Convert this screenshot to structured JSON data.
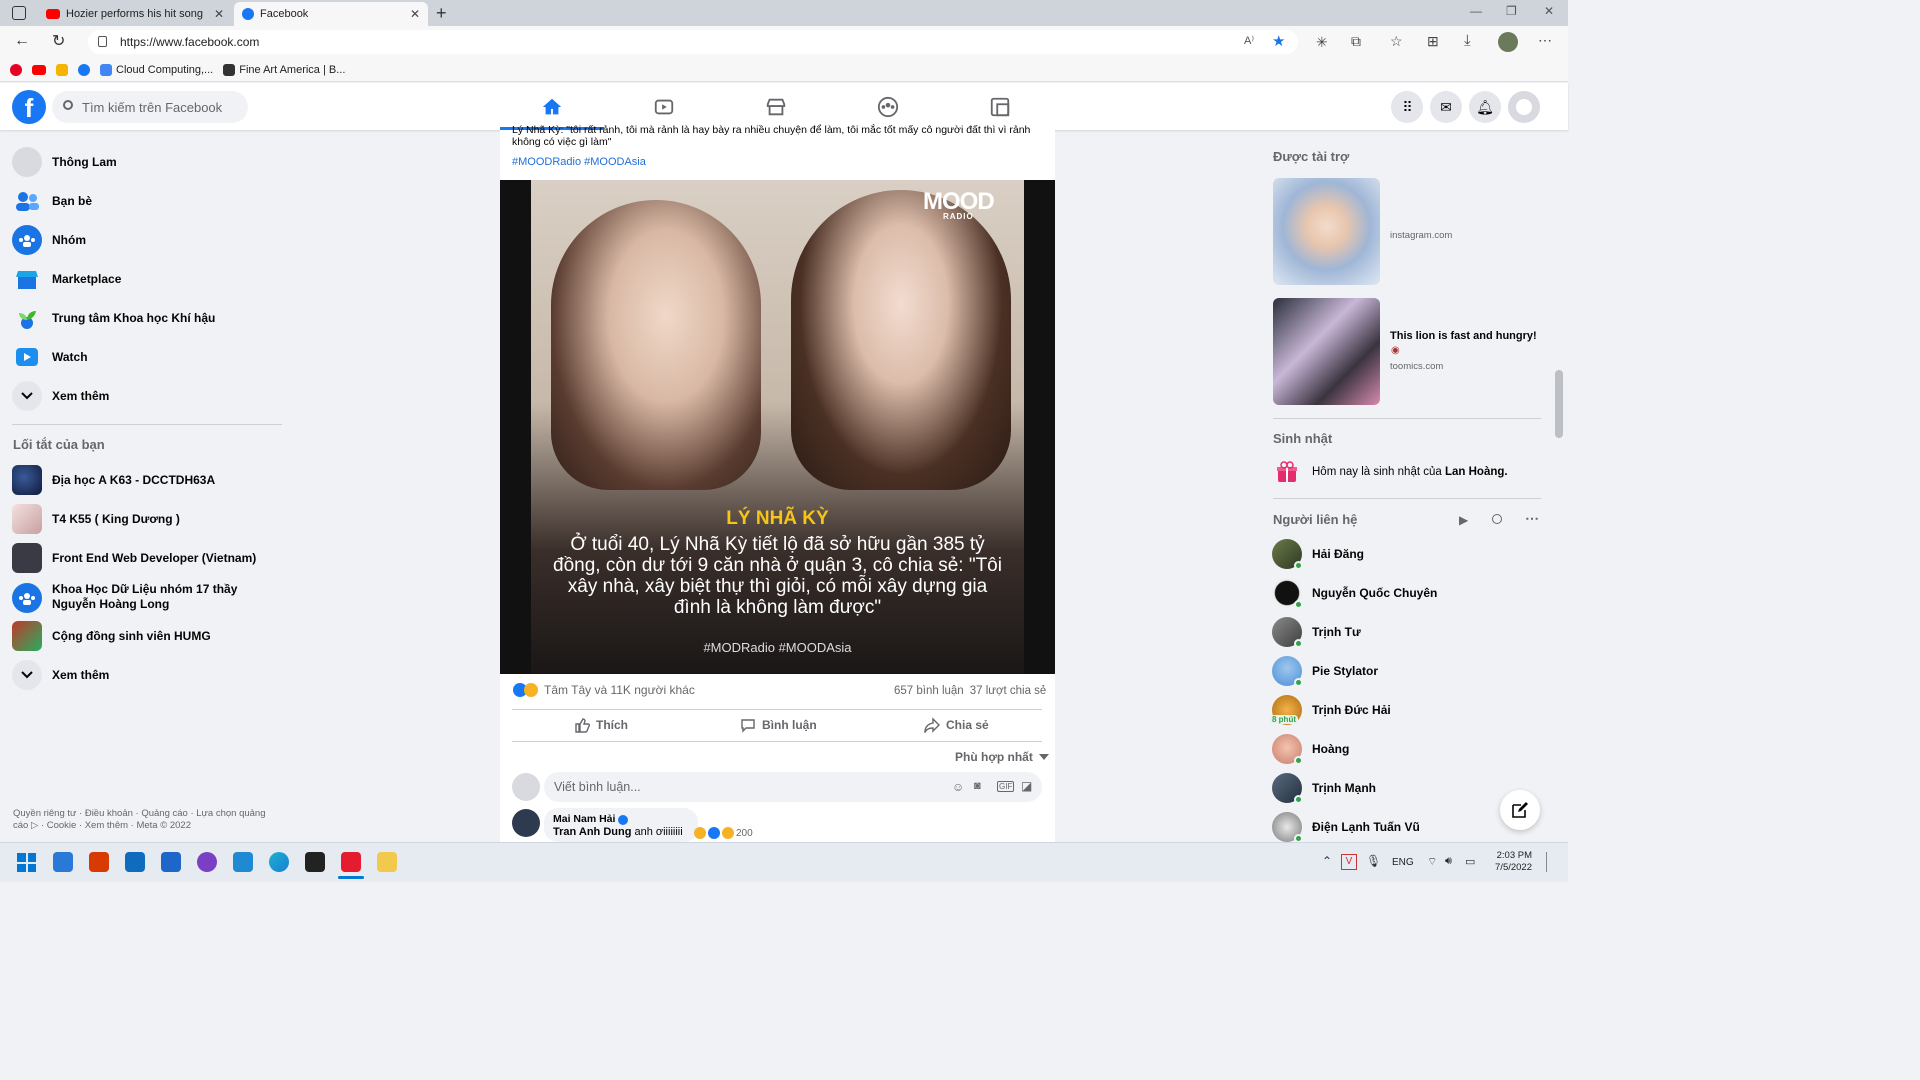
{
  "browser": {
    "tabs": [
      {
        "title": "Hozier performs his hit song 'Tak",
        "active": false
      },
      {
        "title": "Facebook",
        "active": true
      }
    ],
    "url": "https://www.facebook.com",
    "bookmarks": [
      {
        "label": ""
      },
      {
        "label": ""
      },
      {
        "label": ""
      },
      {
        "label": ""
      },
      {
        "label": "Cloud Computing,..."
      },
      {
        "label": "Fine Art America | B..."
      }
    ]
  },
  "facebook": {
    "search_placeholder": "Tìm kiếm trên Facebook",
    "brand_color": "#1877f2"
  },
  "left": {
    "items": [
      {
        "label": "Thông Lam"
      },
      {
        "label": "Bạn bè"
      },
      {
        "label": "Nhóm"
      },
      {
        "label": "Marketplace"
      },
      {
        "label": "Trung tâm Khoa học Khí hậu"
      },
      {
        "label": "Watch"
      },
      {
        "label": "Xem thêm"
      }
    ],
    "shortcuts_title": "Lối tắt của bạn",
    "shortcuts": [
      {
        "label": "Địa học A K63 - DCCTDH63A"
      },
      {
        "label": "T4 K55 ( King Dương )"
      },
      {
        "label": "Front End Web Developer (Vietnam)"
      },
      {
        "label": "Khoa Học Dữ Liệu nhóm 17 thầy Nguyễn Hoàng Long"
      },
      {
        "label": "Cộng đồng sinh viên HUMG"
      }
    ],
    "see_more2": "Xem thêm",
    "footer": "Quyền riêng tư · Điều khoản · Quảng cáo · Lựa chọn quảng cáo ▷ · Cookie · Xem thêm · Meta © 2022"
  },
  "post": {
    "text_cut": "Lý Nhã Kỳ: \"tôi rất rảnh, tôi mà rảnh là hay bày ra nhiều chuyện để làm, tôi mắc tốt mấy cô người đất thì vì rảnh quá,",
    "text_end": "không có việc gì làm\"",
    "hashtags": "#MOODRadio #MOODAsia",
    "image": {
      "logo": "MOOD",
      "logo_sub": "RADIO",
      "headline": "LÝ NHÃ KỲ",
      "body": "Ở tuổi 40, Lý Nhã Kỳ tiết lộ đã sở hữu gần 385 tỷ đồng, còn dư tới 9 căn nhà ở quận 3, cô chia sẻ: \"Tôi xây nhà, xây biệt thự thì giỏi, có mỗi xây dựng gia đình là không làm được\"",
      "footer": "#MODRadio #MOODAsia"
    },
    "reactions": "Tâm Tây và 11K người khác",
    "comments_count": "657 bình luận",
    "shares_count": "37 lượt chia sẻ",
    "actions": {
      "like": "Thích",
      "comment": "Bình luận",
      "share": "Chia sẻ"
    },
    "sort": "Phù hợp nhất",
    "comment_placeholder": "Viết bình luận...",
    "comment": {
      "author": "Mai Nam Hải",
      "mention": "Tran Anh Dung",
      "text": "anh ơiiiiiiii",
      "reaction_count": "200"
    }
  },
  "right": {
    "sponsored_title": "Được tài trợ",
    "ads": [
      {
        "title": "",
        "domain": "instagram.com"
      },
      {
        "title": "This lion is fast and hungry!",
        "domain": "toomics.com"
      }
    ],
    "birthday_title": "Sinh nhật",
    "birthday_prefix": "Hôm nay là sinh nhật của ",
    "birthday_name": "Lan Hoàng.",
    "contacts_title": "Người liên hệ",
    "contacts": [
      {
        "name": "Hải Đăng",
        "status": ""
      },
      {
        "name": "Nguyễn Quốc Chuyên",
        "status": ""
      },
      {
        "name": "Trịnh Tư",
        "status": ""
      },
      {
        "name": "Pie Stylator",
        "status": ""
      },
      {
        "name": "Trịnh Đức Hải",
        "status": "8 phút"
      },
      {
        "name": "Hoàng",
        "status": ""
      },
      {
        "name": "Trịnh Mạnh",
        "status": ""
      },
      {
        "name": "Điện Lạnh Tuấn Vũ",
        "status": ""
      }
    ]
  },
  "taskbar": {
    "lang": "ENG",
    "time": "2:03 PM",
    "date": "7/5/2022"
  }
}
